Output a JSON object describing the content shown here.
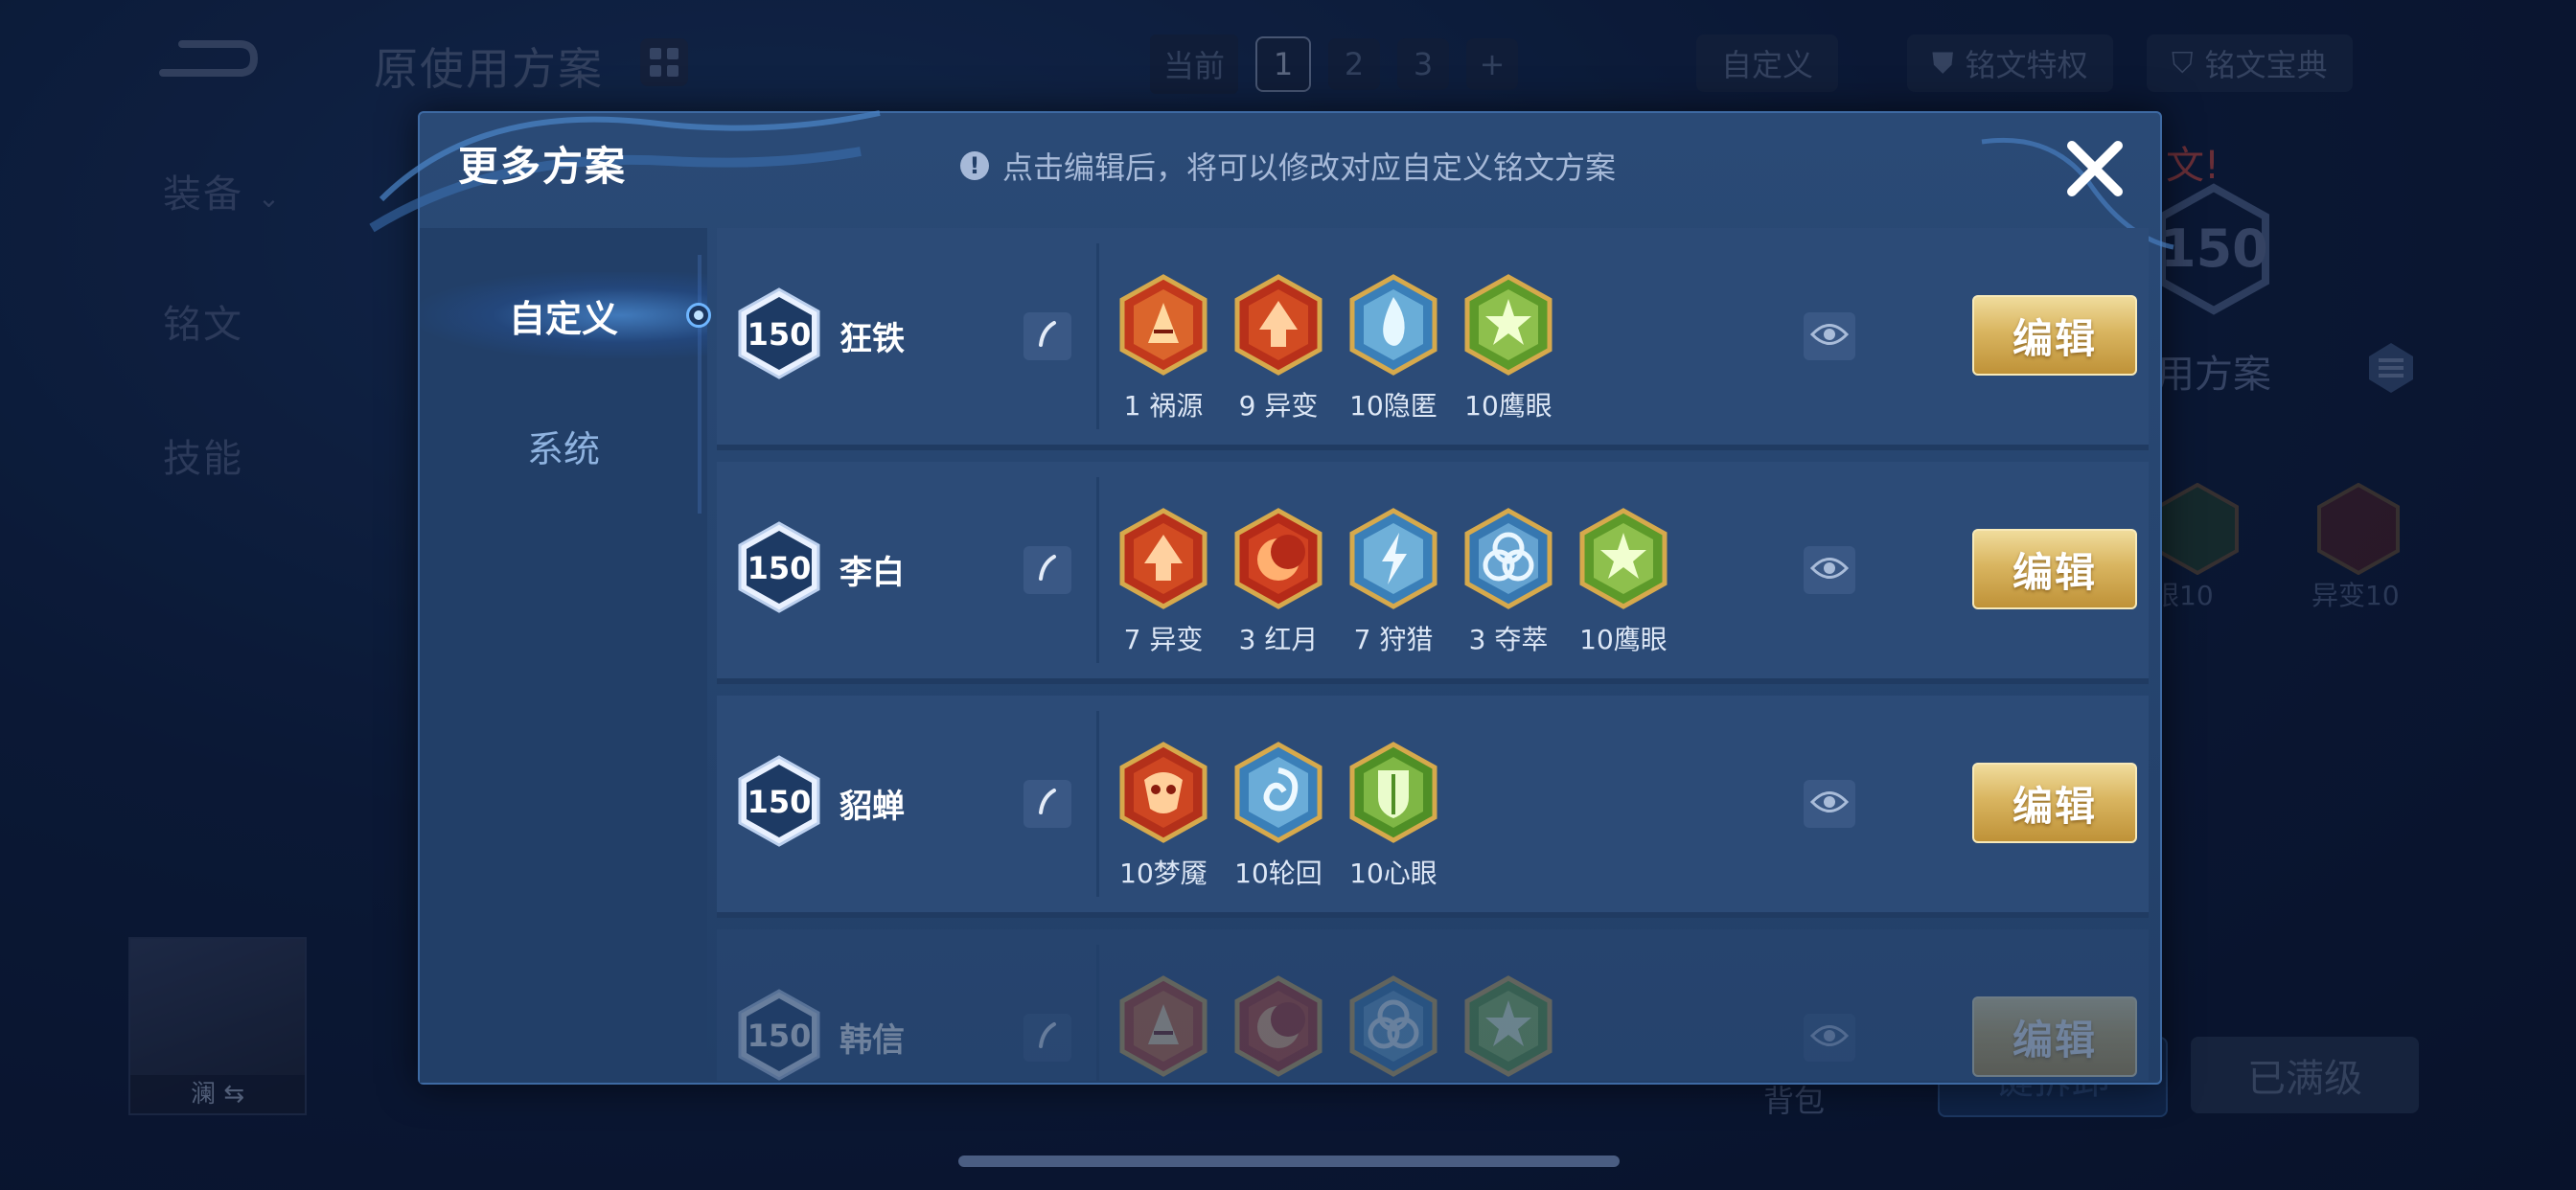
{
  "background": {
    "title": "原使用方案",
    "tabs": {
      "current_label": "当前",
      "numbers": [
        "1",
        "2",
        "3"
      ],
      "active": "1",
      "add": "+"
    },
    "custom_label": "自定义",
    "privilege_label": "铭文特权",
    "codex_label": "铭文宝典",
    "side_nav": [
      "装备",
      "铭文",
      "技能"
    ],
    "hero_name": "澜",
    "right_level": "150",
    "right_title": "用方案",
    "right_warning": "文!",
    "right_runes": [
      "眼10",
      "异变10"
    ],
    "bag_label": "背包",
    "bottom_left_btn": "键拆卸",
    "bottom_right_btn": "已满级"
  },
  "modal": {
    "title": "更多方案",
    "hint": "点击编辑后，将可以修改对应自定义铭文方案",
    "hint_icon": "!",
    "close_icon": "close-x",
    "tabs": [
      {
        "label": "自定义",
        "active": true
      },
      {
        "label": "系统",
        "active": false
      }
    ],
    "edit_label": "编辑",
    "plans": [
      {
        "level": "150",
        "hero": "狂铁",
        "runes": [
          {
            "label": "1 祸源",
            "color": "red-fan"
          },
          {
            "label": "9 异变",
            "color": "red-arrow"
          },
          {
            "label": "10隐匿",
            "color": "blue-flame"
          },
          {
            "label": "10鹰眼",
            "color": "green-star"
          }
        ]
      },
      {
        "level": "150",
        "hero": "李白",
        "runes": [
          {
            "label": "7 异变",
            "color": "red-arrow"
          },
          {
            "label": "3 红月",
            "color": "red-moon"
          },
          {
            "label": "7 狩猎",
            "color": "blue-bolt"
          },
          {
            "label": "3 夺萃",
            "color": "blue-knot"
          },
          {
            "label": "10鹰眼",
            "color": "green-star"
          }
        ]
      },
      {
        "level": "150",
        "hero": "貂蝉",
        "runes": [
          {
            "label": "10梦魇",
            "color": "red-mask"
          },
          {
            "label": "10轮回",
            "color": "blue-swirl"
          },
          {
            "label": "10心眼",
            "color": "green-shield"
          }
        ]
      },
      {
        "level": "150",
        "hero": "韩信",
        "runes": [
          {
            "label": "",
            "color": "red-fan"
          },
          {
            "label": "",
            "color": "red-moon"
          },
          {
            "label": "",
            "color": "blue-knot"
          },
          {
            "label": "",
            "color": "green-star"
          }
        ]
      }
    ]
  },
  "colors": {
    "gold": "#d9b560",
    "modal_bg": "#223f68",
    "row_bg": "#2c4b77",
    "accent_blue": "#6fb6ff"
  }
}
